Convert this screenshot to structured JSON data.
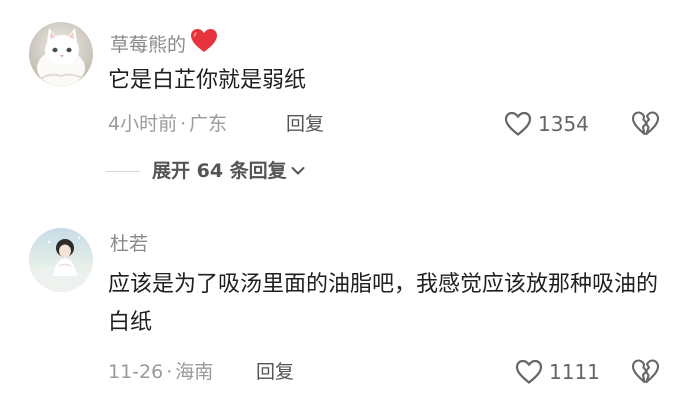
{
  "comments": [
    {
      "username": "草莓熊的",
      "text": "它是白芷你就是弱纸",
      "time": "4小时前",
      "separator": "·",
      "location": "广东",
      "reply_label": "回复",
      "likes": "1354",
      "avatar_icon": "white-cat-avatar",
      "badge_icon": "red-heart-emoji"
    },
    {
      "username": "杜若",
      "text": "应该是为了吸汤里面的油脂吧，我感觉应该放那种吸油的白纸",
      "time": "11-26",
      "separator": "·",
      "location": "海南",
      "reply_label": "回复",
      "likes": "1111",
      "avatar_icon": "girl-photo-avatar"
    }
  ],
  "expand_replies": {
    "label": "展开 64 条回复",
    "icon": "chevron-down-icon"
  },
  "colors": {
    "username": "#8a8a8a",
    "text": "#1f1f1f",
    "meta": "#9a9a9a",
    "action": "#555555",
    "heart": "#e8333d"
  }
}
